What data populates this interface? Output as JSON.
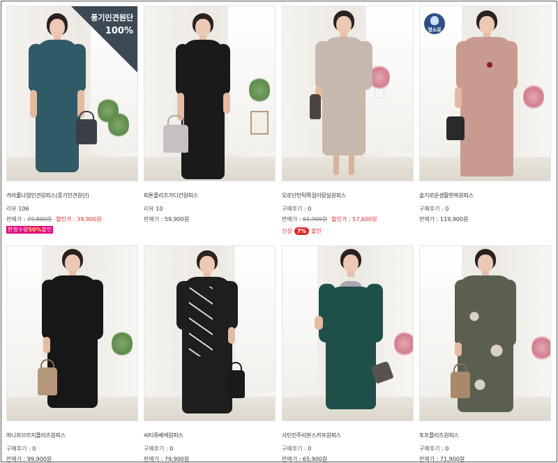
{
  "labels": {
    "review": "리뷰",
    "purchase_review": "구매후기",
    "sell_price": "판매가",
    "discount_price": "할인가",
    "sep": ":"
  },
  "products": [
    {
      "name": "카라풀나염인견원피스(풍기인견원단)",
      "review_label": "리뷰",
      "review_count": "106",
      "original_price": "79,800원",
      "sale_price": "39,900원",
      "ribbon": {
        "line1": "풍기인견원단",
        "line2": "100%"
      },
      "badge_limited": {
        "text": "한정수량",
        "highlight": "50%",
        "suffix": "할인"
      },
      "dress_color": "#2f5a66",
      "bag_color": "#3b3f45"
    },
    {
      "name": "피톤플리츠가디건원피스",
      "review_label": "리뷰",
      "review_count": "10",
      "price": "59,900원",
      "dress_color": "#1a1a1a",
      "bag_color": "#c8bfc2"
    },
    {
      "name": "오로단턴턱쪽걸이랑실원피스",
      "review_label": "구매후기",
      "review_count": "0",
      "original_price": "61,900원",
      "sale_price": "57,600원",
      "badge_new": {
        "prefix": "신상",
        "pct": "7%",
        "suffix": "할인"
      },
      "dress_color": "#c7b8ae",
      "bag_color": "#4a4540"
    },
    {
      "name": "솔기로운생활한복원피스",
      "review_label": "구매후기",
      "review_count": "0",
      "price": "119,900원",
      "seal": {
        "text": "명소로"
      },
      "dress_color": "#c99a8f",
      "bag_color": "#2a2a2a"
    },
    {
      "name": "마니프브르지플리츠원피스",
      "review_label": "구매후기",
      "review_count": "0",
      "price": "99,900원",
      "dress_color": "#171717",
      "bag_color": "#b5977c"
    },
    {
      "name": "씨티쥬베색원피스",
      "review_label": "구매후기",
      "review_count": "0",
      "price": "79,900원",
      "dress_color": "#1e1e1e",
      "bag_color": "#1a1a1a"
    },
    {
      "name": "사틴진주리본스카프원피스",
      "review_label": "구매후기",
      "review_count": "0",
      "price": "65,900원",
      "dress_color": "#1f4f49",
      "bag_color": "#5a534d"
    },
    {
      "name": "토프플리츠원피스",
      "review_label": "구매후기",
      "review_count": "0",
      "price": "71,900원",
      "dress_color": "#5b5f50",
      "bag_color": "#a88a6a"
    }
  ]
}
